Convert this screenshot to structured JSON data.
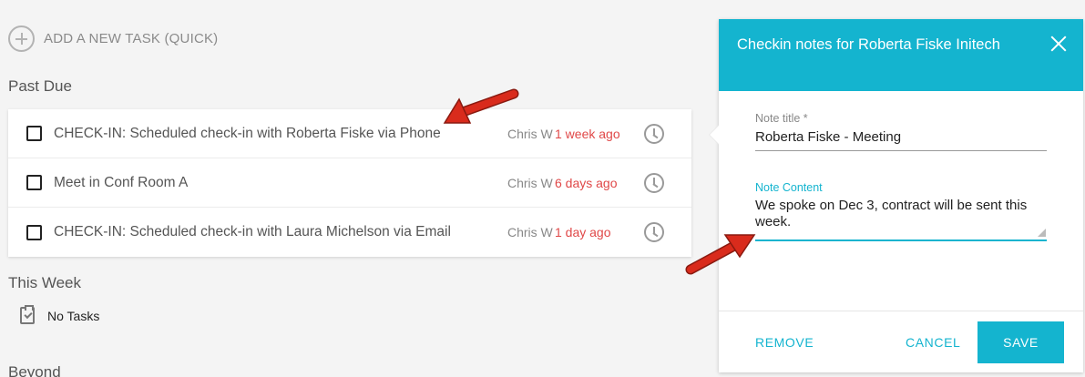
{
  "add_task": {
    "label": "ADD A NEW TASK (QUICK)"
  },
  "sections": {
    "past_due": {
      "title": "Past Due",
      "tasks": [
        {
          "title": "CHECK-IN: Scheduled check-in with Roberta Fiske via Phone",
          "assignee": "Chris W",
          "due": "1 week ago"
        },
        {
          "title": "Meet in Conf Room A",
          "assignee": "Chris W",
          "due": "6 days ago"
        },
        {
          "title": "CHECK-IN: Scheduled check-in with Laura Michelson via Email",
          "assignee": "Chris W",
          "due": "1 day ago"
        }
      ]
    },
    "this_week": {
      "title": "This Week",
      "empty_label": "No Tasks"
    },
    "beyond": {
      "title": "Beyond"
    }
  },
  "panel": {
    "title": "Checkin notes for Roberta Fiske Initech",
    "note_title_label": "Note title *",
    "note_title_value": "Roberta Fiske - Meeting",
    "note_content_label": "Note Content",
    "note_content_value": "We spoke on Dec 3, contract will be sent this week.",
    "remove_label": "REMOVE",
    "cancel_label": "CANCEL",
    "save_label": "SAVE"
  },
  "colors": {
    "accent": "#14b4cf",
    "overdue": "#e04848",
    "annotation_arrow": "#d92b1c"
  }
}
